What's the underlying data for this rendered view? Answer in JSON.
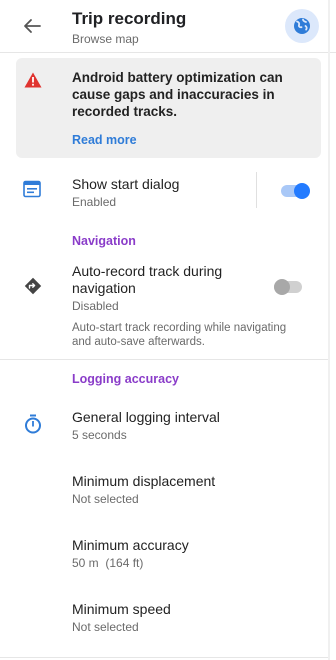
{
  "header": {
    "title": "Trip recording",
    "subtitle": "Browse map"
  },
  "warning": {
    "text": "Android battery optimization can cause gaps and inaccuracies in recorded tracks.",
    "link": "Read more"
  },
  "show_start_dialog": {
    "title": "Show start dialog",
    "status": "Enabled",
    "toggle_on": true
  },
  "navigation": {
    "section_label": "Navigation",
    "auto_record_title": "Auto-record track during navigation",
    "auto_record_status": "Disabled",
    "auto_record_toggle_on": false,
    "auto_record_description": "Auto-start track recording while navigating and auto-save afterwards."
  },
  "logging": {
    "section_label": "Logging accuracy",
    "items": [
      {
        "title": "General logging interval",
        "value": "5 seconds"
      },
      {
        "title": "Minimum displacement",
        "value": "Not selected"
      },
      {
        "title": "Minimum accuracy",
        "value": "50 m  (164 ft)"
      },
      {
        "title": "Minimum speed",
        "value": "Not selected"
      }
    ]
  },
  "colors": {
    "accent": "#2f7cd8",
    "section": "#8a3cc9",
    "warning_icon": "#e0332f",
    "toggle_on": "#237bff"
  }
}
